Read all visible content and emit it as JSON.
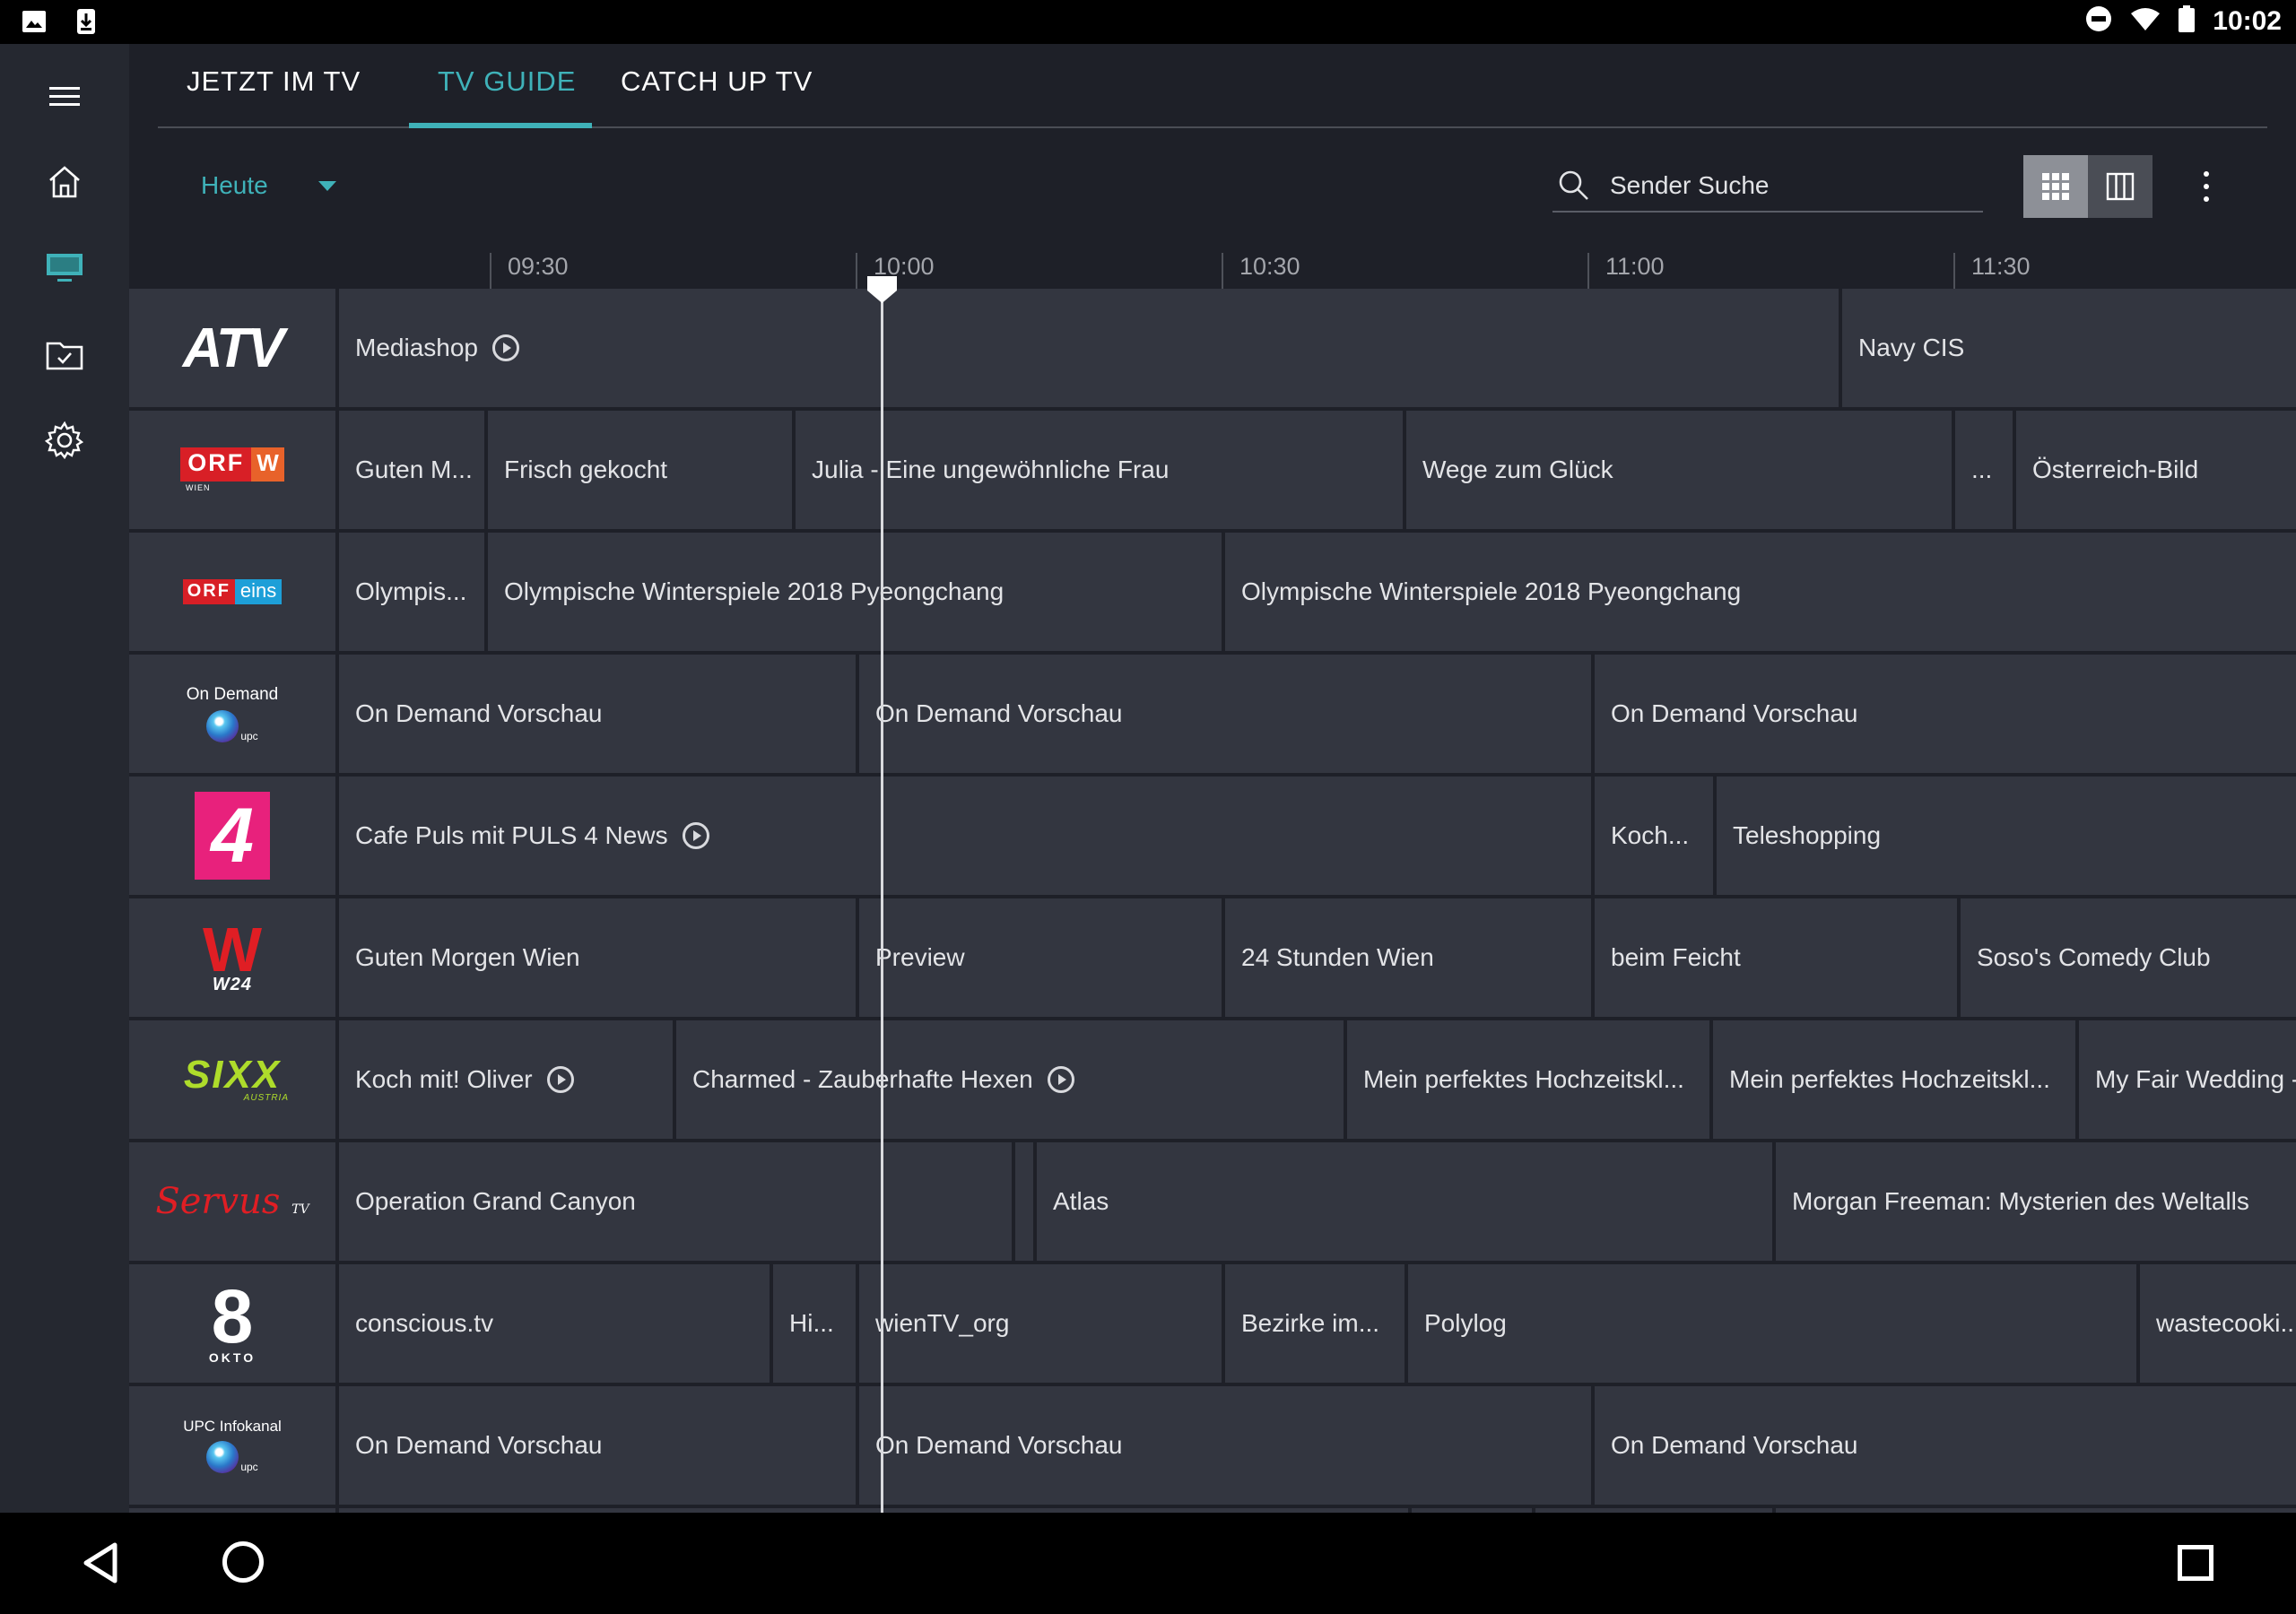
{
  "status_bar": {
    "time": "10:02"
  },
  "tabs": [
    {
      "label": "JETZT IM TV"
    },
    {
      "label": "TV GUIDE"
    },
    {
      "label": "CATCH UP TV"
    }
  ],
  "toolbar": {
    "day": "Heute",
    "search_placeholder": "Sender Suche"
  },
  "timeline": [
    "09:30",
    "10:00",
    "10:30",
    "11:00",
    "11:30"
  ],
  "channels": [
    {
      "logo": "ATV",
      "programs": [
        {
          "title": "Mediashop",
          "replay": true
        },
        {
          "title": "Navy CIS"
        }
      ]
    },
    {
      "logo_left": "ORF",
      "logo_right": "W",
      "logo_sub": "WIEN",
      "programs": [
        {
          "title": "Guten M..."
        },
        {
          "title": "Frisch gekocht"
        },
        {
          "title": "Julia - Eine ungewöhnliche Frau"
        },
        {
          "title": "Wege zum Glück"
        },
        {
          "title": "..."
        },
        {
          "title": "Österreich-Bild"
        }
      ]
    },
    {
      "logo_left": "ORF",
      "logo_right": "eins",
      "programs": [
        {
          "title": "Olympis..."
        },
        {
          "title": "Olympische Winterspiele 2018 Pyeongchang"
        },
        {
          "title": "Olympische Winterspiele 2018 Pyeongchang"
        }
      ]
    },
    {
      "logo": "On Demand",
      "logo_sub": "upc",
      "programs": [
        {
          "title": "On Demand Vorschau"
        },
        {
          "title": "On Demand Vorschau"
        },
        {
          "title": "On Demand Vorschau"
        }
      ]
    },
    {
      "logo": "4",
      "programs": [
        {
          "title": "Cafe Puls mit PULS 4 News",
          "replay": true
        },
        {
          "title": "Koch..."
        },
        {
          "title": "Teleshopping"
        }
      ]
    },
    {
      "logo": "W",
      "logo_sub": "W24",
      "programs": [
        {
          "title": "Guten Morgen Wien"
        },
        {
          "title": "Preview"
        },
        {
          "title": "24 Stunden Wien"
        },
        {
          "title": "beim Feicht"
        },
        {
          "title": "Soso's Comedy Club"
        }
      ]
    },
    {
      "logo": "SIXX",
      "logo_sub": "AUSTRIA",
      "programs": [
        {
          "title": "Koch mit! Oliver",
          "replay": true
        },
        {
          "title": "Charmed - Zauberhafte Hexen",
          "replay": true
        },
        {
          "title": "Mein perfektes Hochzeitskl..."
        },
        {
          "title": "Mein perfektes Hochzeitskl..."
        },
        {
          "title": "My Fair Wedding -"
        }
      ]
    },
    {
      "logo": "Servus",
      "logo_sub": "TV",
      "programs": [
        {
          "title": "Operation Grand Canyon"
        },
        {
          "title": ""
        },
        {
          "title": "Atlas"
        },
        {
          "title": "Morgan Freeman: Mysterien des Weltalls"
        }
      ]
    },
    {
      "logo": "8",
      "logo_sub": "OKTO",
      "programs": [
        {
          "title": "conscious.tv"
        },
        {
          "title": "Hi..."
        },
        {
          "title": "wienTV_org"
        },
        {
          "title": "Bezirke im..."
        },
        {
          "title": "Polylog"
        },
        {
          "title": "wastecooki..."
        }
      ]
    },
    {
      "logo": "UPC Infokanal",
      "logo_sub": "upc",
      "programs": [
        {
          "title": "On Demand Vorschau"
        },
        {
          "title": "On Demand Vorschau"
        },
        {
          "title": "On Demand Vorschau"
        }
      ]
    }
  ],
  "colors": {
    "accent": "#3fb2b9",
    "background": "#1e2028",
    "cell": "#333640"
  }
}
